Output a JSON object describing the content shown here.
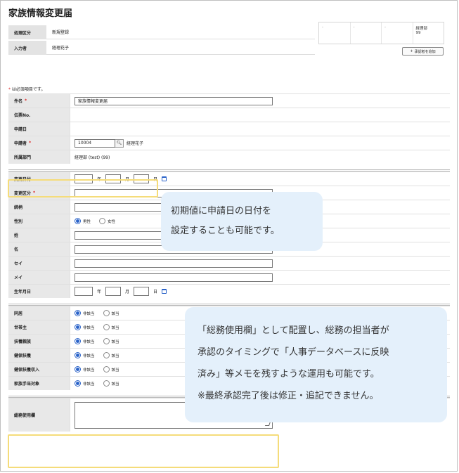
{
  "page": {
    "title": "家族情報変更届"
  },
  "header_info": [
    {
      "label": "処理区分",
      "value": "新規登録"
    },
    {
      "label": "入力者",
      "value": "経理花子"
    }
  ],
  "approvers": [
    "-",
    "-",
    "-",
    "経理部\n99"
  ],
  "add_approver_label": "承認者を追加",
  "required_note": "は必須項目です。",
  "form": {
    "subject": {
      "label": "件名",
      "value": "家族情報変更届"
    },
    "slip_no": {
      "label": "伝票No."
    },
    "apply_date": {
      "label": "申請日"
    },
    "applicant": {
      "label": "申請者",
      "code": "10004",
      "name": "経理花子"
    },
    "department": {
      "label": "所属部門",
      "value": "経理部 (test) (99)"
    },
    "change_date": {
      "label": "変更日付"
    },
    "change_type": {
      "label": "変更区分"
    },
    "relation": {
      "label": "続柄"
    },
    "gender": {
      "label": "性別",
      "options": [
        "男性",
        "女性"
      ],
      "selected": 0
    },
    "last_name": {
      "label": "姓"
    },
    "first_name": {
      "label": "名"
    },
    "last_name_kana": {
      "label": "セイ"
    },
    "first_name_kana": {
      "label": "メイ"
    },
    "birth_date": {
      "label": "生年月日"
    },
    "cohabit": {
      "label": "同居"
    },
    "household_head": {
      "label": "世帯主"
    },
    "dependent": {
      "label": "扶養親族"
    },
    "health_dependent": {
      "label": "健保扶養"
    },
    "health_dependent_income": {
      "label": "健保扶養収入"
    },
    "family_allowance": {
      "label": "家族手当対象"
    },
    "admin_notes": {
      "label": "総務使用欄"
    }
  },
  "yes_no_options": [
    "非該当",
    "該当"
  ],
  "date_units": {
    "year": "年",
    "month": "月",
    "day": "日"
  },
  "callout_1": [
    "初期値に申請日の日付を",
    "設定することも可能です。"
  ],
  "callout_2": [
    "「総務使用欄」として配置し、総務の担当者が",
    "承認のタイミングで「人事データベースに反映",
    "済み」等メモを残すような運用も可能です。",
    "※最終承認完了後は修正・追記できません。"
  ]
}
